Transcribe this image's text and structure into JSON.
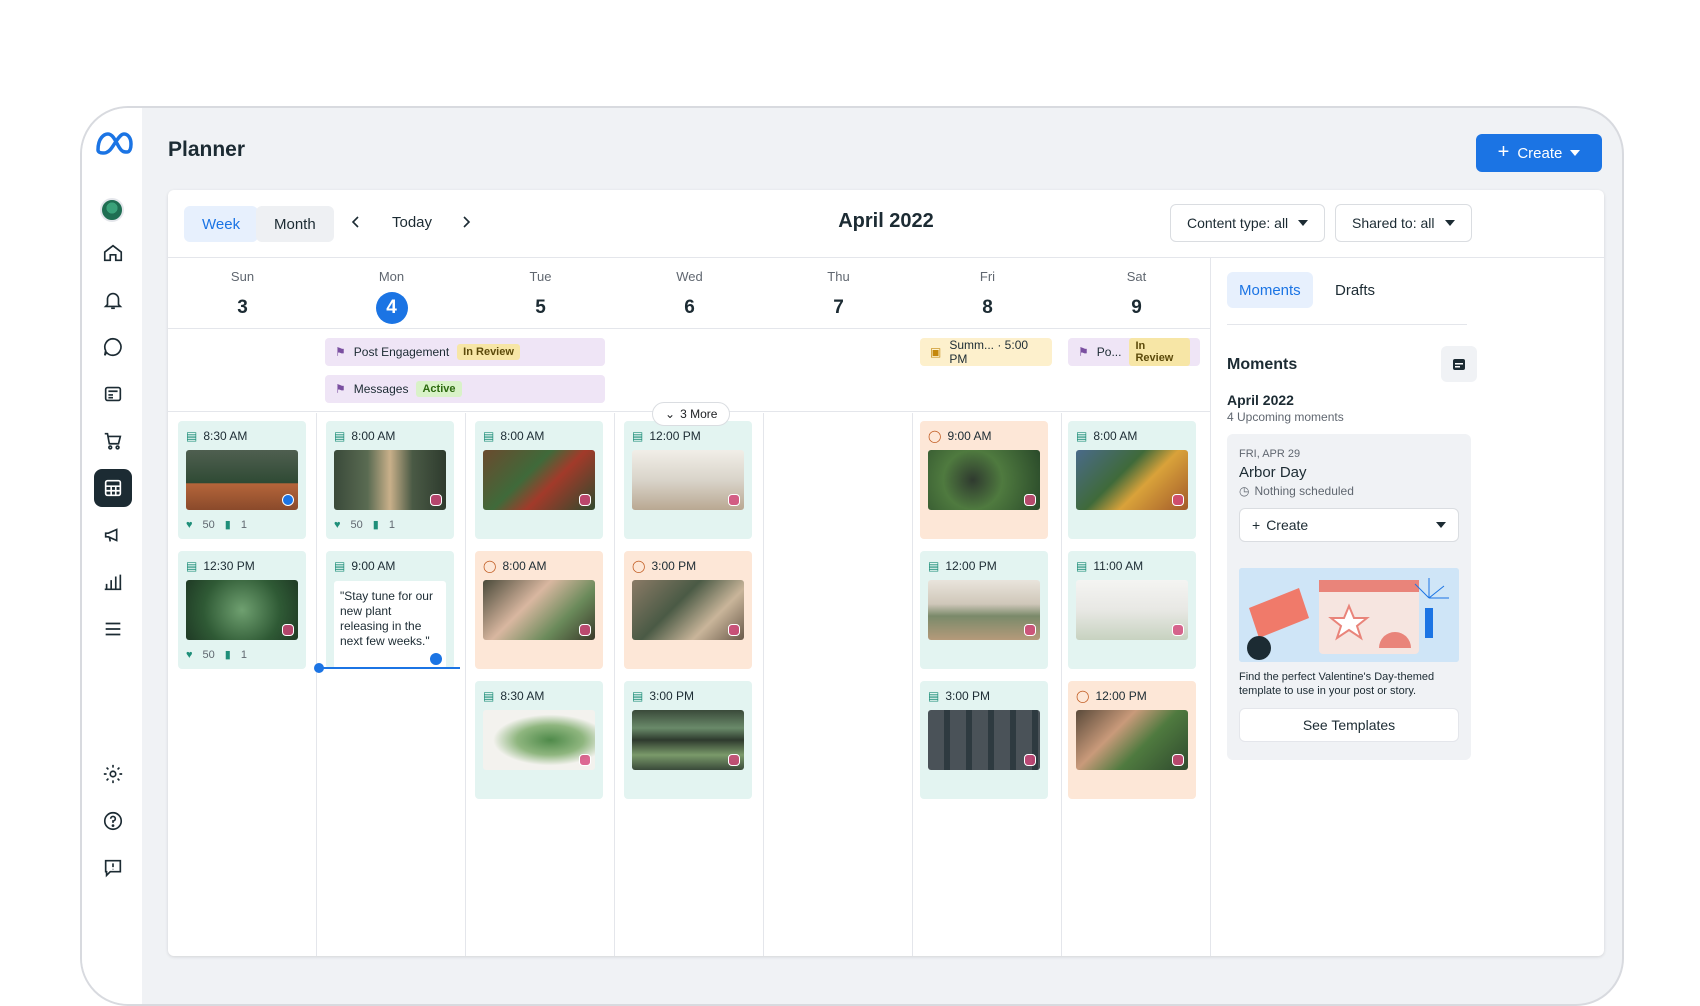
{
  "app": {
    "title": "Planner",
    "create_label": "Create"
  },
  "toolbar": {
    "week": "Week",
    "month": "Month",
    "today": "Today",
    "period": "April 2022",
    "content_filter": "Content type: all",
    "shared_filter": "Shared to: all"
  },
  "days": [
    {
      "dow": "Sun",
      "num": "3"
    },
    {
      "dow": "Mon",
      "num": "4"
    },
    {
      "dow": "Tue",
      "num": "5"
    },
    {
      "dow": "Wed",
      "num": "6"
    },
    {
      "dow": "Thu",
      "num": "7"
    },
    {
      "dow": "Fri",
      "num": "8"
    },
    {
      "dow": "Sat",
      "num": "9"
    }
  ],
  "allday": {
    "post_engagement": {
      "label": "Post Engagement",
      "status": "In Review"
    },
    "messages": {
      "label": "Messages",
      "status": "Active"
    },
    "summ": {
      "label": "Summ... · 5:00 PM"
    },
    "po": {
      "label": "Po...",
      "status": "In Review"
    },
    "more": "3 More"
  },
  "posts": {
    "sun1": {
      "time": "8:30 AM",
      "likes": "50",
      "comments": "1"
    },
    "sun2": {
      "time": "12:30 PM",
      "likes": "50",
      "comments": "1"
    },
    "mon1": {
      "time": "8:00 AM",
      "likes": "50",
      "comments": "1"
    },
    "mon2": {
      "time": "9:00 AM",
      "quote": "\"Stay tune for our new plant releasing in the next few weeks.\""
    },
    "tue1": {
      "time": "8:00 AM"
    },
    "tue2": {
      "time": "8:00 AM"
    },
    "tue3": {
      "time": "8:30 AM"
    },
    "wed1": {
      "time": "12:00 PM"
    },
    "wed2": {
      "time": "3:00 PM"
    },
    "wed3": {
      "time": "3:00 PM"
    },
    "fri1": {
      "time": "9:00 AM"
    },
    "fri2": {
      "time": "12:00 PM"
    },
    "fri3": {
      "time": "3:00 PM"
    },
    "sat1": {
      "time": "8:00 AM"
    },
    "sat2": {
      "time": "11:00 AM"
    },
    "sat3": {
      "time": "12:00 PM"
    }
  },
  "side": {
    "tab_moments": "Moments",
    "tab_drafts": "Drafts",
    "heading": "Moments",
    "month": "April 2022",
    "upcoming": "4 Upcoming moments",
    "card": {
      "date": "FRI, APR 29",
      "name": "Arbor Day",
      "status": "Nothing scheduled",
      "create": "Create",
      "promo": "Find the perfect Valentine's Day-themed template to use in your post or story.",
      "button": "See Templates"
    }
  },
  "colors": {
    "accent": "#1b74e4",
    "published": "#e3f4f1",
    "scheduled": "#fde7d7",
    "allday": "#efe5f6"
  }
}
